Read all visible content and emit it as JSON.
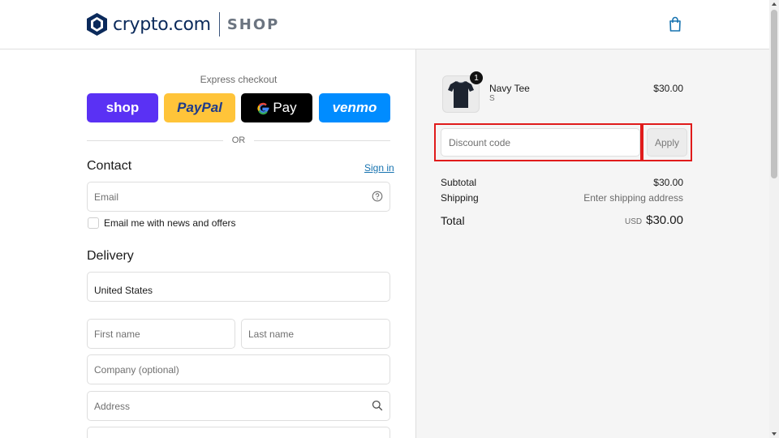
{
  "header": {
    "brand": "crypto.com",
    "store_label": "SHOP",
    "cart_icon": "shopping-bag-icon"
  },
  "express": {
    "label": "Express checkout",
    "buttons": {
      "shop": "shop",
      "paypal": "PayPal",
      "gpay": "Pay",
      "venmo": "venmo"
    },
    "separator": "OR"
  },
  "contact": {
    "title": "Contact",
    "sign_in": "Sign in",
    "email_placeholder": "Email",
    "newsletter_label": "Email me with news and offers"
  },
  "delivery": {
    "title": "Delivery",
    "country": "United States",
    "first_name_placeholder": "First name",
    "last_name_placeholder": "Last name",
    "company_placeholder": "Company (optional)",
    "address_placeholder": "Address"
  },
  "summary": {
    "item": {
      "name": "Navy Tee",
      "variant": "S",
      "price": "$30.00",
      "quantity": "1"
    },
    "discount_placeholder": "Discount code",
    "apply_label": "Apply",
    "subtotal_label": "Subtotal",
    "subtotal_value": "$30.00",
    "shipping_label": "Shipping",
    "shipping_value": "Enter shipping address",
    "total_label": "Total",
    "total_currency": "USD",
    "total_value": "$30.00"
  },
  "colors": {
    "brand_navy": "#0b2a5b",
    "shop_pay": "#5a31f4",
    "paypal": "#ffc439",
    "venmo": "#008cff",
    "highlight": "#e01b1b",
    "link": "#1773b0"
  }
}
